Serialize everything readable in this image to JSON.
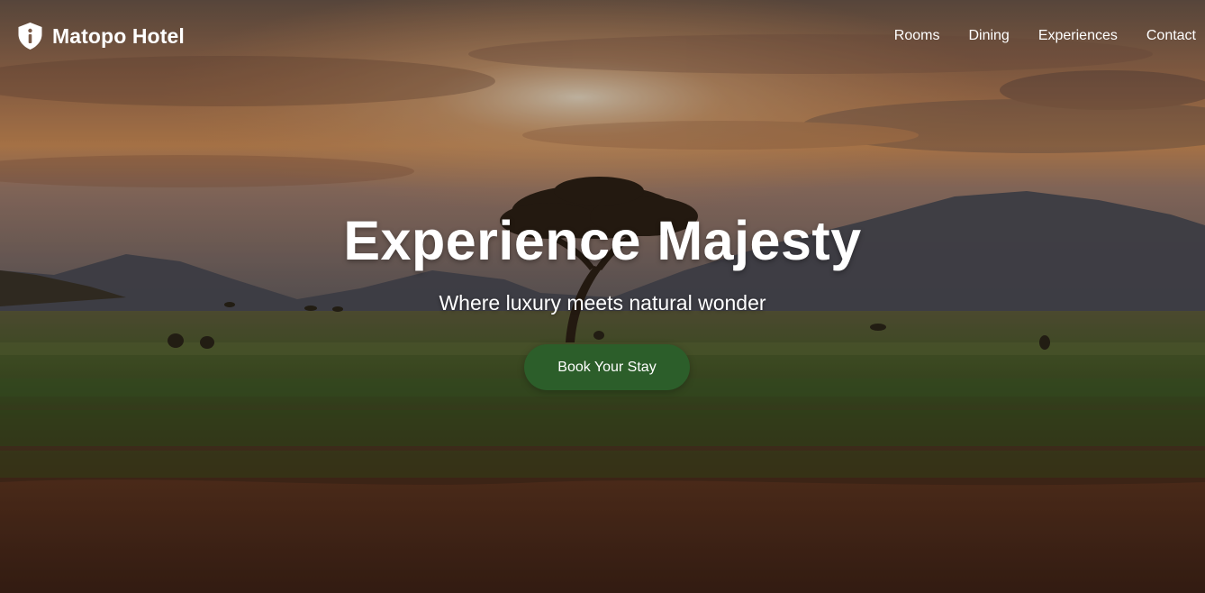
{
  "brand": {
    "name": "Matopo Hotel",
    "icon": "shield-info-icon"
  },
  "nav": {
    "items": [
      {
        "label": "Rooms"
      },
      {
        "label": "Dining"
      },
      {
        "label": "Experiences"
      },
      {
        "label": "Contact"
      }
    ]
  },
  "hero": {
    "title": "Experience Majesty",
    "subtitle": "Where luxury meets natural wonder",
    "cta_label": "Book Your Stay",
    "background": "savanna-sunset-acacia-tree-photo"
  },
  "colors": {
    "cta_background": "#2c5e2a",
    "text": "#ffffff"
  }
}
